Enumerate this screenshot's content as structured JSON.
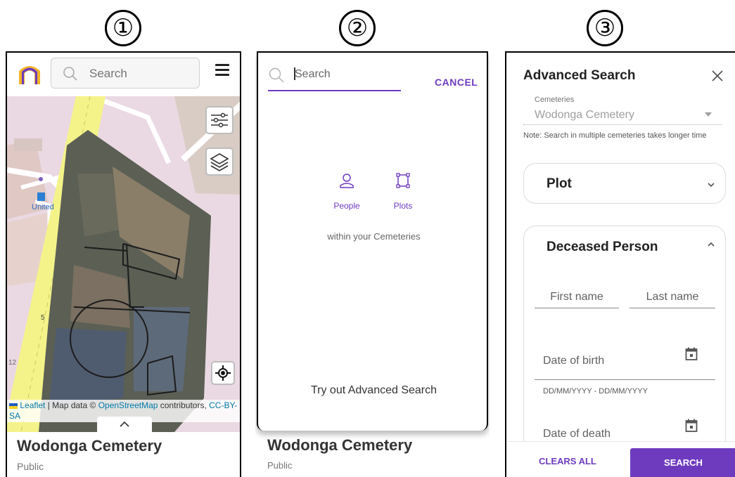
{
  "steps": [
    "①",
    "②",
    "③"
  ],
  "panel1": {
    "search_placeholder": "Search",
    "map_labels": {
      "station": "United",
      "number_five": "5",
      "road_number": "12"
    },
    "attribution": {
      "leaflet": "Leaflet",
      "sep": " | Map data © ",
      "osm": "OpenStreetMap",
      "contrib": " contributors, ",
      "license": "CC-BY-SA"
    },
    "cemetery_name": "Wodonga Cemetery",
    "cemetery_type": "Public",
    "icons": [
      "app-logo-icon",
      "search-icon",
      "menu-icon",
      "filter-sliders-icon",
      "layers-icon",
      "locate-icon",
      "chevron-up-icon"
    ]
  },
  "panel2": {
    "search_value": "Search",
    "cancel_label": "CANCEL",
    "options": [
      {
        "label": "People",
        "icon": "person-icon"
      },
      {
        "label": "Plots",
        "icon": "plot-icon"
      }
    ],
    "scope_text": "within your Cemeteries",
    "advanced_link": "Try out Advanced Search",
    "cemetery_name": "Wodonga Cemetery",
    "cemetery_type": "Public"
  },
  "panel3": {
    "title": "Advanced Search",
    "cemeteries_label": "Cemeteries",
    "cemeteries_value": "Wodonga Cemetery",
    "note": "Note: Search in multiple cemeteries takes longer time",
    "sections": {
      "plot": "Plot",
      "deceased": "Deceased Person"
    },
    "fields": {
      "first_name": "First name",
      "last_name": "Last name",
      "date_of_birth": "Date of birth",
      "dob_hint": "DD/MM/YYYY - DD/MM/YYYY",
      "date_of_death": "Date of death"
    },
    "clear_label": "CLEARS ALL",
    "search_label": "SEARCH"
  },
  "colors": {
    "accent": "#6e3bbf",
    "map_bg": "#ead9e2",
    "road": "#f4f38a",
    "imagery": "#5b5f54",
    "link": "#0078a8"
  }
}
